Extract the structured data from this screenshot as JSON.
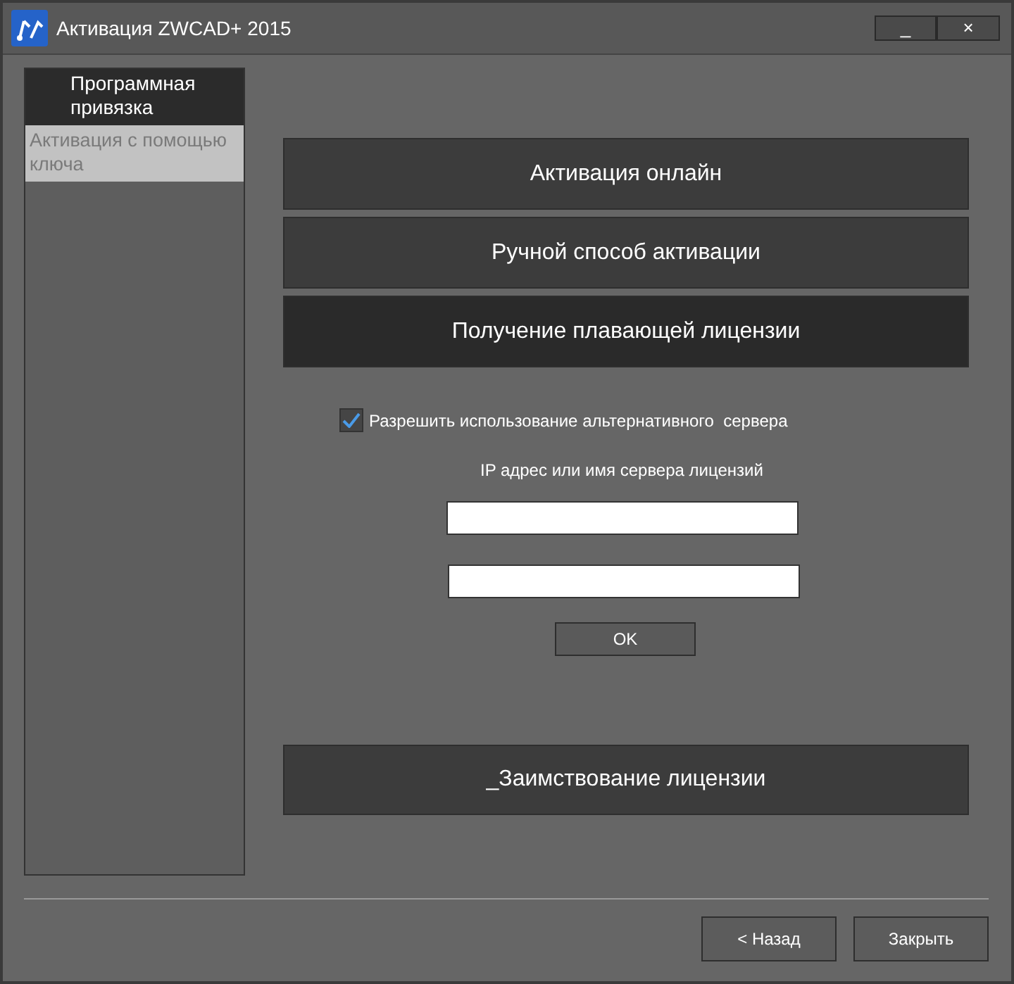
{
  "window": {
    "title": "Активация ZWCAD+ 2015",
    "controls": [
      "_",
      "×"
    ]
  },
  "sidebar": {
    "items": [
      {
        "label": "Программная привязка",
        "selected": true
      },
      {
        "label": "Активация с помощью ключа",
        "selected": false
      }
    ]
  },
  "modes": [
    {
      "label": "Активация онлайн",
      "selected": false
    },
    {
      "label": "Ручной способ активации",
      "selected": false
    },
    {
      "label": "Получение плавающей лицензии",
      "selected": true
    }
  ],
  "alt_server": {
    "label": "Разрешить использование альтернативного  сервера",
    "checked": true
  },
  "server_label": "IP адрес или имя сервера лицензий",
  "server_fields": [
    {
      "kind": "text"
    },
    {
      "kind": "text"
    }
  ],
  "ok_button": "OK",
  "borrow_button": "_Заимствование лицензии",
  "footer_buttons": [
    "< Назад",
    "Закрыть"
  ]
}
